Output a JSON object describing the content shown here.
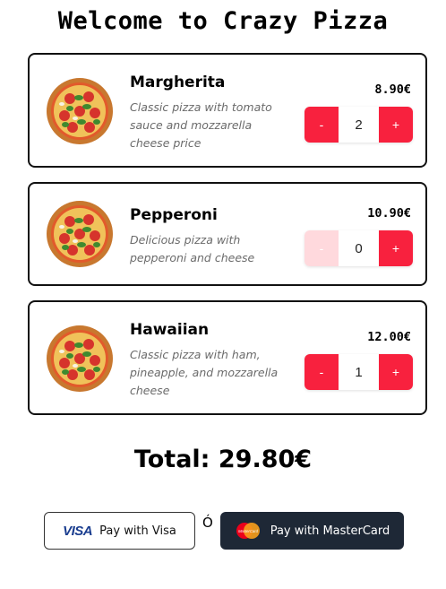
{
  "header": {
    "title": "Welcome to Crazy Pizza"
  },
  "products": [
    {
      "name": "Margherita",
      "description": "Classic pizza with tomato sauce and mozzarella cheese price",
      "price": "8.90€",
      "quantity": "2",
      "minus_label": "-",
      "plus_label": "+"
    },
    {
      "name": "Pepperoni",
      "description": "Delicious pizza with pepperoni and cheese",
      "price": "10.90€",
      "quantity": "0",
      "minus_label": "-",
      "plus_label": "+"
    },
    {
      "name": "Hawaiian",
      "description": "Classic pizza with ham, pineapple, and mozzarella cheese",
      "price": "12.00€",
      "quantity": "1",
      "minus_label": "-",
      "plus_label": "+"
    }
  ],
  "summary": {
    "total": "Total: 29.80€"
  },
  "payment": {
    "visa_logo": "VISA",
    "visa_label": "Pay with Visa",
    "separator": "Ó",
    "mastercard_logo": "MasterCard",
    "mastercard_label": "Pay with MasterCard"
  },
  "colors": {
    "accent": "#f8213e",
    "accent_disabled": "#ffd9dd",
    "mastercard_button": "#1e2836",
    "visa_blue": "#1a3d8f"
  },
  "icons": {
    "product_image": "pizza-icon",
    "mastercard": "mastercard-logo-icon",
    "visa": "visa-logo-icon"
  }
}
